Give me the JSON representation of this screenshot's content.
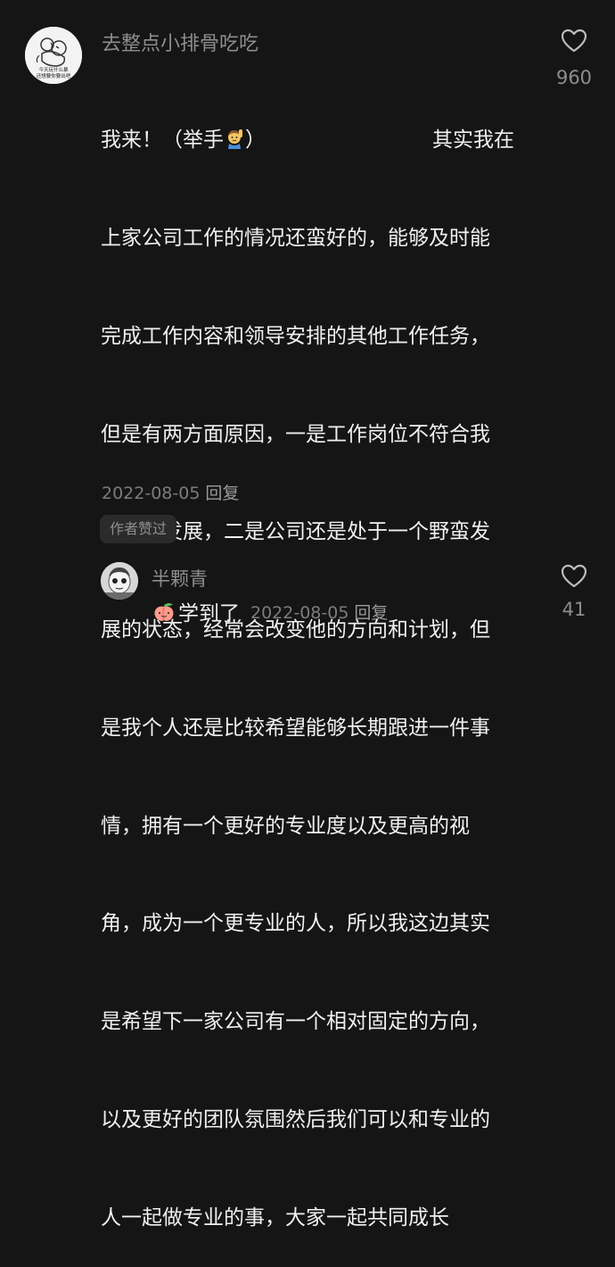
{
  "main_comment": {
    "username": "去整点小排骨吃吃",
    "avatar_caption_1": "今天玩什么暴",
    "avatar_caption_2": "还想要你要出吧",
    "text_first_line_start": "我来！（举手",
    "text_first_line_end": "）",
    "text_first_line_tail": "其实我在",
    "raise_hand_emoji": "raising-hand-emoji",
    "lines": [
      "上家公司工作的情况还蛮好的，能够及时能",
      "完成工作内容和领导安排的其他工作任务，",
      "但是有两方面原因，一是工作岗位不符合我",
      "的职业发展，二是公司还是处于一个野蛮发",
      "展的状态，经常会改变他的方向和计划，但",
      "是我个人还是比较希望能够长期跟进一件事",
      "情，拥有一个更好的专业度以及更高的视",
      "角，成为一个更专业的人，所以我这边其实",
      "是希望下一家公司有一个相对固定的方向，",
      "以及更好的团队氛围然后我们可以和专业的",
      "人一起做专业的事，大家一起共同成长"
    ],
    "date": "2022-08-05",
    "reply_label": "回复",
    "author_liked": "作者赞过",
    "like_count": "960"
  },
  "reply_comment": {
    "username": "半颗青",
    "emoji": "peach-emoji",
    "text": "学到了",
    "date": "2022-08-05",
    "reply_label": "回复",
    "like_count": "41"
  },
  "colors": {
    "background": "#151515",
    "primary_text": "#f0f0f0",
    "secondary_text": "#8d8d8d"
  }
}
